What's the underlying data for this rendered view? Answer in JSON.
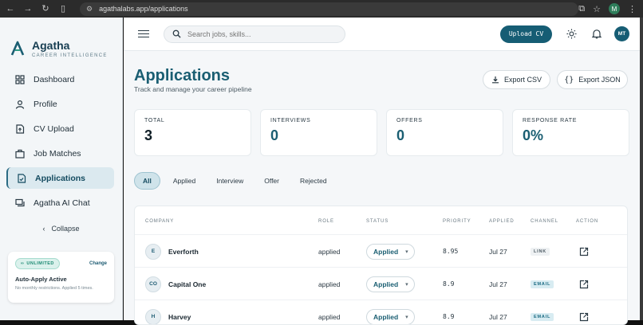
{
  "browser": {
    "url": "agathalabs.app/applications",
    "profile_initial": "M"
  },
  "brand": {
    "name": "Agatha",
    "tagline": "CAREER INTELLIGENCE"
  },
  "sidebar": {
    "items": [
      {
        "label": "Dashboard",
        "icon": "grid-icon"
      },
      {
        "label": "Profile",
        "icon": "user-icon"
      },
      {
        "label": "CV Upload",
        "icon": "file-upload-icon"
      },
      {
        "label": "Job Matches",
        "icon": "briefcase-icon"
      },
      {
        "label": "Applications",
        "icon": "document-check-icon",
        "active": true
      },
      {
        "label": "Agatha AI Chat",
        "icon": "chat-icon"
      }
    ],
    "collapse_label": "Collapse",
    "promo": {
      "badge": "UNLIMITED",
      "change_label": "Change",
      "title": "Auto-Apply Active",
      "subtitle": "No monthly restrictions. Applied 5 times."
    }
  },
  "topbar": {
    "search_placeholder": "Search jobs, skills...",
    "upload_label": "Upload CV",
    "avatar_initials": "MT"
  },
  "page": {
    "title": "Applications",
    "subtitle": "Track and manage your career pipeline",
    "export_csv": "Export CSV",
    "export_json": "Export JSON"
  },
  "stats": [
    {
      "label": "TOTAL",
      "value": "3"
    },
    {
      "label": "INTERVIEWS",
      "value": "0"
    },
    {
      "label": "OFFERS",
      "value": "0"
    },
    {
      "label": "RESPONSE RATE",
      "value": "0%"
    }
  ],
  "filters": [
    "All",
    "Applied",
    "Interview",
    "Offer",
    "Rejected"
  ],
  "table": {
    "headers": [
      "COMPANY",
      "ROLE",
      "STATUS",
      "PRIORITY",
      "APPLIED",
      "CHANNEL",
      "ACTION"
    ],
    "rows": [
      {
        "initials": "E",
        "company": "Everforth",
        "role": "applied",
        "status": "Applied",
        "priority": "8.95",
        "applied": "Jul 27",
        "channel": "LINK"
      },
      {
        "initials": "CO",
        "company": "Capital One",
        "role": "applied",
        "status": "Applied",
        "priority": "8.9",
        "applied": "Jul 27",
        "channel": "EMAIL"
      },
      {
        "initials": "H",
        "company": "Harvey",
        "role": "applied",
        "status": "Applied",
        "priority": "8.9",
        "applied": "Jul 27",
        "channel": "EMAIL"
      }
    ]
  },
  "colors": {
    "accent": "#165d74",
    "title": "#1a5e72"
  }
}
